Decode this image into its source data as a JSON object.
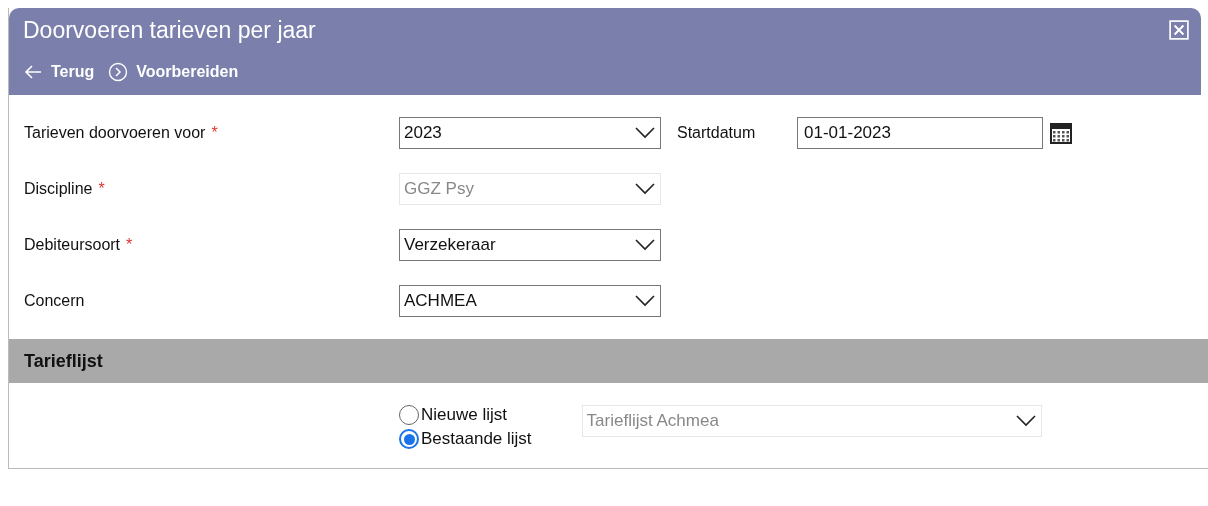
{
  "window": {
    "title": "Doorvoeren tarieven per jaar"
  },
  "toolbar": [
    {
      "label": "Terug",
      "kind": "back"
    },
    {
      "label": "Voorbereiden",
      "kind": "next"
    }
  ],
  "fields": [
    {
      "label": "Tarieven doorvoeren voor",
      "required_mark": "*",
      "value": "2023",
      "disabled": false,
      "date": {
        "label": "Startdatum",
        "value": "01-01-2023"
      }
    },
    {
      "label": "Discipline",
      "required_mark": "*",
      "value": "GGZ Psy",
      "disabled": true
    },
    {
      "label": "Debiteursoort",
      "required_mark": "*",
      "value": "Verzekeraar",
      "disabled": false
    },
    {
      "label": "Concern",
      "value": "ACHMEA",
      "disabled": false
    }
  ],
  "section": {
    "title": "Tarieflijst",
    "options": [
      {
        "label": "Nieuwe lijst",
        "selected": false
      },
      {
        "label": "Bestaande lijst",
        "selected": true
      }
    ],
    "list": {
      "value": "Tarieflijst Achmea",
      "disabled": true
    }
  }
}
